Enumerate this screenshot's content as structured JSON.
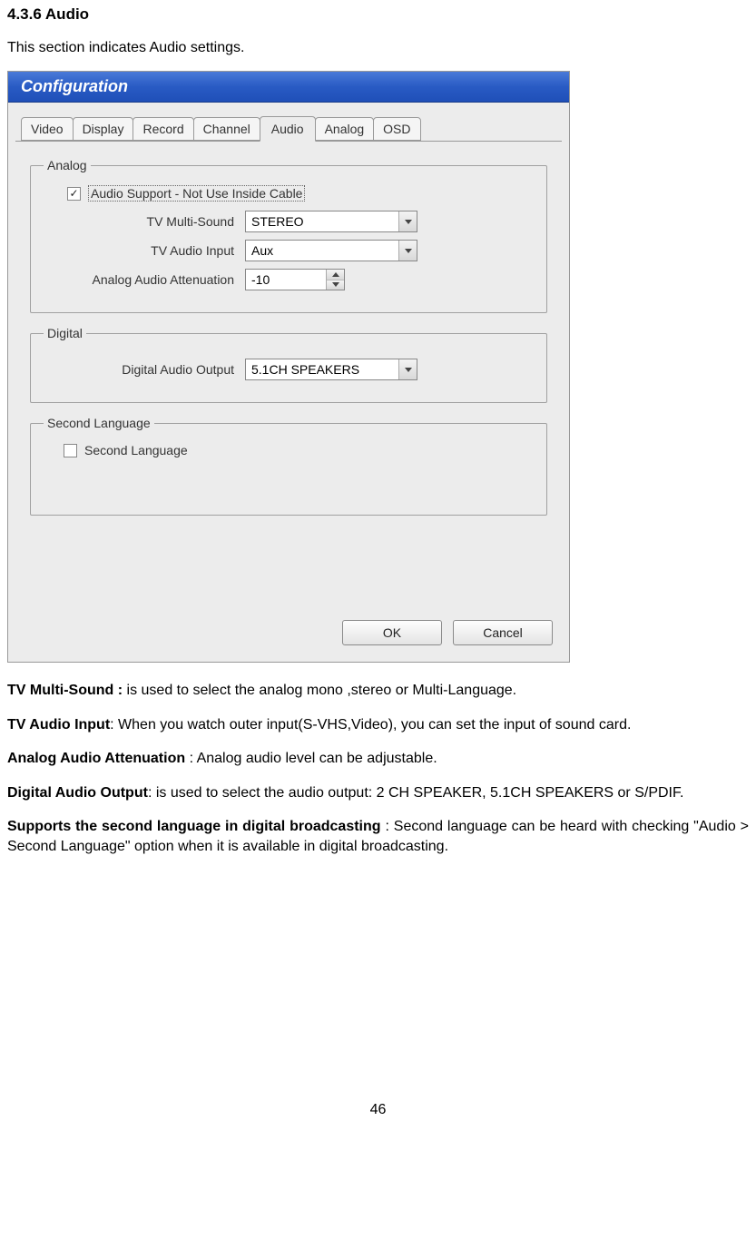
{
  "heading": "4.3.6       Audio",
  "intro": "This section indicates Audio settings.",
  "window": {
    "title": "Configuration",
    "tabs": [
      "Video",
      "Display",
      "Record",
      "Channel",
      "Audio",
      "Analog",
      "OSD"
    ],
    "active_tab_index": 4,
    "groups": {
      "analog": {
        "legend": "Analog",
        "audio_support_checked": true,
        "audio_support_label": "Audio Support - Not Use Inside Cable",
        "tv_multi_sound_label": "TV Multi-Sound",
        "tv_multi_sound_value": "STEREO",
        "tv_audio_input_label": "TV Audio Input",
        "tv_audio_input_value": "Aux",
        "attenuation_label": "Analog Audio Attenuation",
        "attenuation_value": "-10"
      },
      "digital": {
        "legend": "Digital",
        "output_label": "Digital Audio Output",
        "output_value": "5.1CH SPEAKERS"
      },
      "second_lang": {
        "legend": "Second Language",
        "checked": false,
        "label": "Second Language"
      }
    },
    "buttons": {
      "ok": "OK",
      "cancel": "Cancel"
    }
  },
  "descriptions": {
    "d1_b": "TV Multi-Sound : ",
    "d1_t": "is used to select the analog mono ,stereo or Multi-Language.",
    "d2_b": "TV Audio Input",
    "d2_t": ": When you watch outer input(S-VHS,Video), you can set the input of sound card.",
    "d3_b": "Analog Audio Attenuation",
    "d3_t": " : Analog audio level can be adjustable.",
    "d4_b": "Digital Audio Output",
    "d4_t": ": is used to select the audio output: 2 CH SPEAKER, 5.1CH SPEAKERS or S/PDIF.",
    "d5_b": "Supports the second language in digital broadcasting",
    "d5_t": " : Second language can be heard with checking \"Audio > Second Language\" option when it is available in digital broadcasting."
  },
  "page_number": "46"
}
